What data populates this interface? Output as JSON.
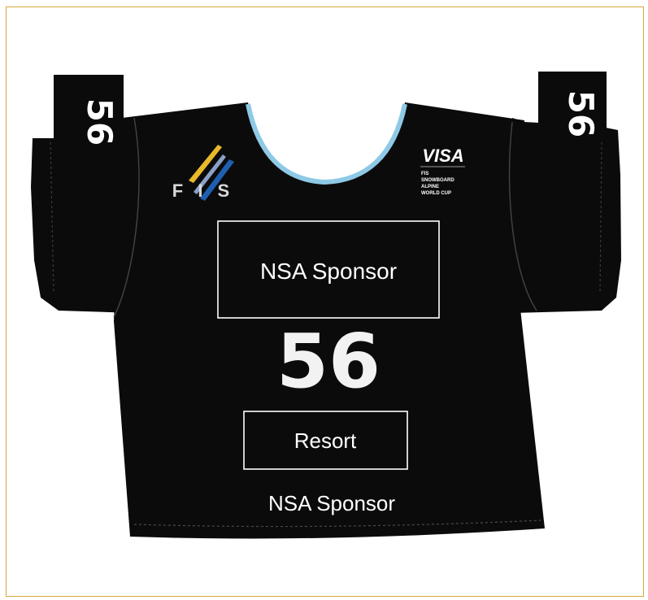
{
  "bib": {
    "number": "56",
    "sleeve_left_number": "56",
    "sleeve_right_number": "56",
    "fis_logo_text": "F I S",
    "visa_logo": "VISA",
    "event_lines": [
      "FIS",
      "SNOWBOARD",
      "ALPINE",
      "WORLD CUP"
    ],
    "chest_sponsor_label": "NSA Sponsor",
    "resort_label": "Resort",
    "bottom_sponsor_label": "NSA Sponsor"
  },
  "colors": {
    "frame_border": "#d6a93a",
    "bib_body": "#0b0b0b",
    "collar_trim": "#8ec9e6",
    "text": "#ffffff",
    "fis_blue": "#1f5fb0",
    "fis_yellow": "#e9b92a"
  }
}
